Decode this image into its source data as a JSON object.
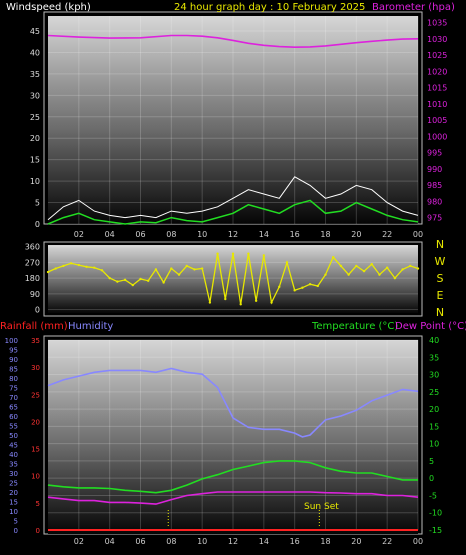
{
  "chart_data": [
    {
      "type": "line",
      "title": "24 hour graph day : 10 February 2025",
      "ylabel_left": "Windspeed (kph)",
      "ylabel_right": "Barometer (hpa)",
      "x_ticks": [
        "02",
        "04",
        "06",
        "08",
        "10",
        "12",
        "14",
        "16",
        "18",
        "20",
        "22",
        "00"
      ],
      "xlim": [
        0,
        24
      ],
      "y_left_ticks": [
        0,
        5,
        10,
        15,
        20,
        25,
        30,
        35,
        40,
        45
      ],
      "ylim_left": [
        0,
        48.5
      ],
      "y_right_ticks": [
        975,
        980,
        985,
        990,
        995,
        1000,
        1005,
        1010,
        1015,
        1020,
        1025,
        1030,
        1035
      ],
      "ylim_right": [
        973,
        1037
      ],
      "colors": {
        "wind_gust": "#ffffff",
        "wind_avg": "#22dd22",
        "barometer": "#dd22dd"
      },
      "series": [
        {
          "name": "Barometer (hpa)",
          "axis": "right",
          "x": [
            0,
            2,
            4,
            6,
            8,
            9,
            10,
            11,
            12,
            13,
            14,
            15,
            16,
            17,
            18,
            19,
            20,
            21,
            22,
            23,
            24
          ],
          "values": [
            1031,
            1030.5,
            1030.2,
            1030.3,
            1031,
            1031,
            1030.8,
            1030.3,
            1029.5,
            1028.6,
            1028,
            1027.6,
            1027.4,
            1027.5,
            1027.8,
            1028.3,
            1028.8,
            1029.2,
            1029.6,
            1029.9,
            1030
          ]
        },
        {
          "name": "Windspeed (kph)",
          "axis": "left",
          "x": [
            0,
            1,
            2,
            3,
            4,
            5,
            6,
            7,
            8,
            9,
            10,
            11,
            12,
            13,
            14,
            15,
            16,
            17,
            18,
            19,
            20,
            21,
            22,
            23,
            24
          ],
          "values": [
            0,
            1.5,
            2.5,
            1,
            0.5,
            0,
            0.5,
            0.3,
            1.5,
            0.8,
            0.5,
            1.5,
            2.5,
            4.5,
            3.5,
            2.5,
            4.5,
            5.5,
            2.5,
            3,
            5,
            3.5,
            2,
            1,
            0.5
          ]
        },
        {
          "name": "Wind gust (kph)",
          "axis": "left",
          "x": [
            0,
            1,
            2,
            3,
            4,
            5,
            6,
            7,
            8,
            9,
            10,
            11,
            12,
            13,
            14,
            15,
            16,
            17,
            18,
            19,
            20,
            21,
            22,
            23,
            24
          ],
          "values": [
            1,
            4,
            5.5,
            3,
            2,
            1.5,
            2,
            1.5,
            3,
            2.5,
            3,
            4,
            6,
            8,
            7,
            6,
            11,
            9,
            6,
            7,
            9,
            8,
            5,
            3,
            2
          ]
        }
      ]
    },
    {
      "type": "scatter",
      "ylabel_right": "N W S E N",
      "compass_labels": [
        "N",
        "W",
        "S",
        "E",
        "N"
      ],
      "y_left_ticks": [
        0,
        90,
        180,
        270,
        360
      ],
      "ylim": [
        -20,
        370
      ],
      "xlim": [
        0,
        24
      ],
      "colors": {
        "direction": "#e8e800"
      },
      "series": [
        {
          "name": "Wind direction",
          "x": [
            0,
            0.5,
            1,
            1.5,
            2,
            2.5,
            3,
            3.5,
            4,
            4.5,
            5,
            5.5,
            6,
            6.5,
            7,
            7.5,
            8,
            8.5,
            9,
            9.5,
            10,
            10.5,
            11,
            11.5,
            12,
            12.5,
            13,
            13.5,
            14,
            14.5,
            15,
            15.5,
            16,
            16.5,
            17,
            17.5,
            18,
            18.5,
            19,
            19.5,
            20,
            20.5,
            21,
            21.5,
            22,
            22.5,
            23,
            23.5,
            24
          ],
          "values": [
            215,
            235,
            250,
            265,
            255,
            245,
            240,
            225,
            180,
            160,
            170,
            140,
            175,
            165,
            230,
            155,
            235,
            200,
            250,
            230,
            235,
            40,
            320,
            60,
            320,
            30,
            320,
            50,
            310,
            40,
            130,
            270,
            110,
            125,
            145,
            135,
            200,
            300,
            250,
            200,
            250,
            220,
            260,
            200,
            240,
            180,
            230,
            250,
            235
          ]
        }
      ]
    },
    {
      "type": "line",
      "ylabel_left_1": "Rainfall (mm)",
      "ylabel_left_2": "Humidity",
      "ylabel_right_1": "Temperature (°C)",
      "ylabel_right_2": "Dew Point (°C)",
      "annotation": "Sun Set",
      "x_ticks": [
        "02",
        "04",
        "06",
        "08",
        "10",
        "12",
        "14",
        "16",
        "18",
        "20",
        "22",
        "00"
      ],
      "xlim": [
        0,
        24
      ],
      "humidity_ticks": [
        0,
        5,
        10,
        15,
        20,
        25,
        30,
        35,
        40,
        45,
        50,
        55,
        60,
        65,
        70,
        75,
        80,
        85,
        90,
        95,
        100
      ],
      "ylim_humidity": [
        0,
        100
      ],
      "rain_ticks": [
        0,
        5,
        10,
        15,
        20,
        25,
        30,
        35
      ],
      "ylim_rain": [
        0,
        35
      ],
      "temp_ticks": [
        -15,
        -10,
        -5,
        0,
        5,
        10,
        15,
        20,
        25,
        30,
        35,
        40
      ],
      "ylim_temp": [
        -15,
        40
      ],
      "sun_markers_x": [
        7.8,
        17.6
      ],
      "colors": {
        "humidity": "#8888ff",
        "temperature": "#22dd22",
        "dew_point": "#dd22dd",
        "rainfall": "#ff2222"
      },
      "series": [
        {
          "name": "Humidity",
          "axis": "humidity",
          "x": [
            0,
            1,
            2,
            3,
            4,
            5,
            6,
            7,
            8,
            9,
            10,
            11,
            12,
            13,
            14,
            15,
            16,
            16.5,
            17,
            18,
            19,
            20,
            21,
            22,
            23,
            24
          ],
          "values": [
            76,
            79,
            81,
            83,
            84,
            84,
            84,
            83,
            85,
            83,
            82,
            75,
            59,
            54,
            53,
            53,
            51,
            49,
            50,
            58,
            60,
            63,
            68,
            71,
            74,
            73
          ]
        },
        {
          "name": "Temperature (°C)",
          "axis": "temp",
          "x": [
            0,
            1,
            2,
            3,
            4,
            5,
            6,
            7,
            8,
            9,
            10,
            11,
            12,
            13,
            14,
            15,
            16,
            17,
            18,
            19,
            20,
            21,
            22,
            23,
            24
          ],
          "values": [
            -2,
            -2.5,
            -2.8,
            -2.8,
            -3,
            -3.5,
            -3.8,
            -4.2,
            -3.5,
            -2,
            -0.2,
            1,
            2.5,
            3.5,
            4.5,
            5,
            5,
            4.5,
            3,
            2,
            1.5,
            1.5,
            0.5,
            -0.5,
            -0.5
          ]
        },
        {
          "name": "Dew Point (°C)",
          "axis": "temp",
          "x": [
            0,
            1,
            2,
            3,
            4,
            5,
            6,
            7,
            8,
            9,
            10,
            11,
            12,
            13,
            14,
            15,
            16,
            17,
            18,
            19,
            20,
            21,
            22,
            23,
            24
          ],
          "values": [
            -5.5,
            -6,
            -6.5,
            -6.5,
            -7,
            -7,
            -7.2,
            -7.5,
            -6.2,
            -5,
            -4.5,
            -4,
            -4,
            -4,
            -4,
            -4,
            -4,
            -4,
            -4.2,
            -4.3,
            -4.5,
            -4.5,
            -5,
            -5,
            -5.5
          ]
        },
        {
          "name": "Rainfall (mm)",
          "axis": "rain",
          "x": [
            0,
            24
          ],
          "values": [
            0,
            0
          ]
        }
      ]
    }
  ]
}
